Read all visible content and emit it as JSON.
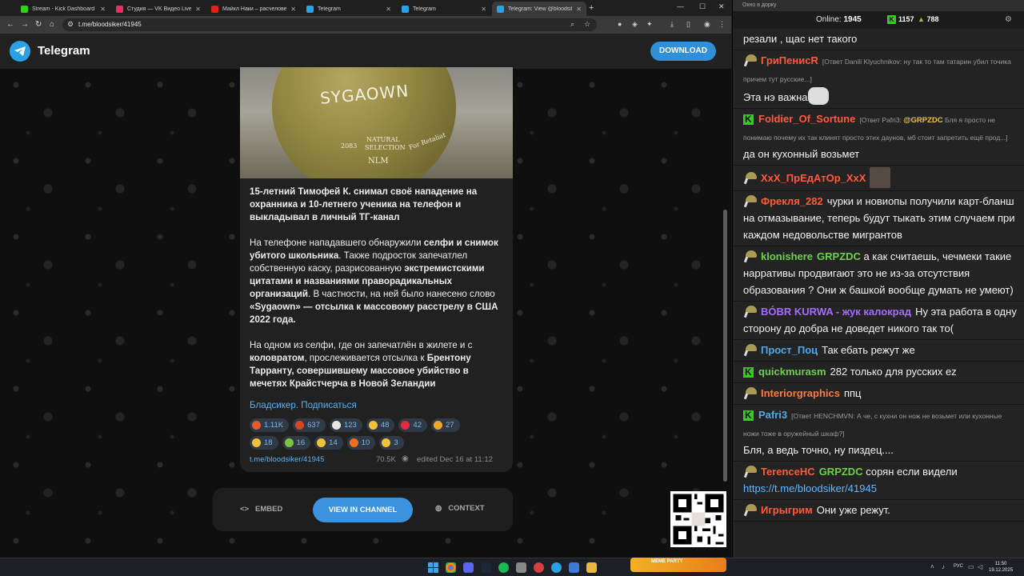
{
  "browser": {
    "tabs": [
      {
        "title": "Stream - Kick Dashboard",
        "favicon_color": "#31d11a",
        "active": false
      },
      {
        "title": "Студия — VK Видео Live",
        "favicon_color": "#e8305f",
        "active": false
      },
      {
        "title": "Майкл Наки – расчеловечива...",
        "favicon_color": "#e62117",
        "active": false
      },
      {
        "title": "Telegram",
        "favicon_color": "#2aa1e4",
        "active": false
      },
      {
        "title": "Telegram",
        "favicon_color": "#2aa1e4",
        "active": false
      },
      {
        "title": "Telegram: View @bloodsiker",
        "favicon_color": "#2aa1e4",
        "active": true
      }
    ],
    "new_tab": "+",
    "url": "t.me/bloodsiker/41945"
  },
  "telegram": {
    "title": "Telegram",
    "download_label": "DOWNLOAD",
    "post": {
      "photo_word": "SYGAOWN",
      "photo_scribbles": [
        "2083",
        "NATURAL",
        "SELECTION",
        "NLM",
        "For Retaliat"
      ],
      "headline": "15-летний Тимофей К. снимал своё нападение на охранника и 10-летнего ученика на телефон и выкладывал в личный ТГ-канал",
      "para2_parts": [
        {
          "t": "На телефоне нападавшего обнаружили ",
          "b": false
        },
        {
          "t": "селфи и снимок убитого школьника",
          "b": true
        },
        {
          "t": ". Также подросток запечатлел собственную каску, разрисованную ",
          "b": false
        },
        {
          "t": "экстремистскими цитатами и названиями праворадикальных организаций",
          "b": true
        },
        {
          "t": ". В частности, на ней было нанесено слово ",
          "b": false
        },
        {
          "t": "«Sygaown» — отсылка к массовому расстрелу в США 2022 года.",
          "b": true
        }
      ],
      "para3_parts": [
        {
          "t": "На одном из селфи, где он запечатлён в жилете и с ",
          "b": false
        },
        {
          "t": "коловратом",
          "b": true
        },
        {
          "t": ", прослеживается отсылка к ",
          "b": false
        },
        {
          "t": "Брентону Тарранту, совершившему массовое убийство в мечетях Крайстчерча в Новой Зеландии",
          "b": true
        }
      ],
      "subscribe": "Бладсикер. Подписаться",
      "reactions_row1": [
        {
          "emoji": "angry-face-icon",
          "color": "#e8592b",
          "count": "1.11K"
        },
        {
          "emoji": "cursing-face-icon",
          "color": "#d9471f",
          "count": "637"
        },
        {
          "emoji": "clown-face-icon",
          "color": "#f0e6e0",
          "count": "123"
        },
        {
          "emoji": "thumbs-up-icon",
          "color": "#f2c13c",
          "count": "48"
        },
        {
          "emoji": "heart-icon",
          "color": "#e8283a",
          "count": "42"
        },
        {
          "emoji": "pill-icon",
          "color": "#f0a62c",
          "count": "27"
        }
      ],
      "reactions_row2": [
        {
          "emoji": "sad-face-icon",
          "color": "#f2c13c",
          "count": "18"
        },
        {
          "emoji": "nauseated-face-icon",
          "color": "#7cc444",
          "count": "16"
        },
        {
          "emoji": "smirk-face-icon",
          "color": "#f2c13c",
          "count": "14"
        },
        {
          "emoji": "fire-icon",
          "color": "#f36d1e",
          "count": "10"
        },
        {
          "emoji": "grimace-face-icon",
          "color": "#f2c13c",
          "count": "3"
        }
      ],
      "link": "t.me/bloodsiker/41945",
      "views": "70.5K",
      "edited": "edited  Dec 16 at 11:12"
    },
    "bottom": {
      "embed": "EMBED",
      "view_in_channel": "VIEW IN CHANNEL",
      "context": "CONTEXT"
    }
  },
  "chat": {
    "window_title": "Окно в дорку",
    "online_label": "Online:",
    "online_count": "1945",
    "kick_count": "1157",
    "second_count": "788",
    "messages": [
      {
        "avatar": "none",
        "user": "",
        "user_color": "#fff",
        "reply": "",
        "text": "резали , щас нет такого"
      },
      {
        "avatar": "helmet",
        "user": "ГриПенисR",
        "user_color": "#ff5a3c",
        "reply": "[Ответ Danili Klyuchnikov: ну так то там татарин убил точика причем тут русские...]",
        "text": "Эта нэ важна",
        "emote": "light"
      },
      {
        "avatar": "kick",
        "user": "Foldier_Of_Sortune",
        "user_color": "#ff5a3c",
        "reply_pre": "[Ответ Pafri3: ",
        "reply_mention": "@GRPZDC",
        "reply": " Бля я просто не понимаю почему их так клинят просто этих даунов, мб стоит запретить ещё прод...]",
        "text": "да он кухонный возьмет"
      },
      {
        "avatar": "helmet",
        "user": "XxX_ПрЕдАтОр_XxX",
        "user_color": "#ff5a3c",
        "reply": "",
        "text": "",
        "emote": "dark"
      },
      {
        "avatar": "helmet",
        "user": "Фрекля_282",
        "user_color": "#ff5a3c",
        "reply": "",
        "text": "чурки и новиопы получили карт-бланш на отмазывание, теперь будут тыкать этим случаем при каждом недовольстве мигрантов"
      },
      {
        "avatar": "helmet",
        "user": "klonishere",
        "user_color": "#6ecf4a",
        "mention": "GRPZDC",
        "reply": "",
        "text": "а как считаешь, чечмеки такие нарративы продвигают это не из-за отсутствия образования ? Они ж башкой вообще думать не умеют)"
      },
      {
        "avatar": "helmet",
        "user": "BÓBR KURWA - жук калокрад",
        "user_color": "#a56bff",
        "reply": "",
        "text": "Ну эта работа в одну сторону до добра не доведет никого так то("
      },
      {
        "avatar": "helmet",
        "user": "Прост_Поц",
        "user_color": "#4fa9e8",
        "reply": "",
        "text": "Так ебать режут же"
      },
      {
        "avatar": "kick",
        "user": "quickmurasm",
        "user_color": "#6ecf4a",
        "reply": "",
        "text": "282 только для русских ez"
      },
      {
        "avatar": "helmet",
        "user": "Interiorgraphics",
        "user_color": "#ff7a3c",
        "reply": "",
        "text": "ппц"
      },
      {
        "avatar": "kick",
        "user": "Pafri3",
        "user_color": "#4fa9e8",
        "reply": "[Ответ HENCHMVN: А че, с кухни он нож не возьмет или кухонные ножи тоже в оружейный шкаф?]",
        "text": "Бля, а ведь точно, ну пиздец...."
      },
      {
        "avatar": "helmet",
        "user": "TerenceHC",
        "user_color": "#ff5a3c",
        "mention": "GRPZDC",
        "reply": "",
        "text": "сорян если видели ",
        "link": "https://t.me/bloodsiker/41945"
      },
      {
        "avatar": "helmet",
        "user": "Игрыгрим",
        "user_color": "#ff5a3c",
        "reply": "",
        "text": "Они уже режут."
      }
    ]
  },
  "taskbar": {
    "meme_party": "MEME PARTY",
    "lang": "РУС",
    "time": "11:50",
    "date": "19.12.2025"
  }
}
